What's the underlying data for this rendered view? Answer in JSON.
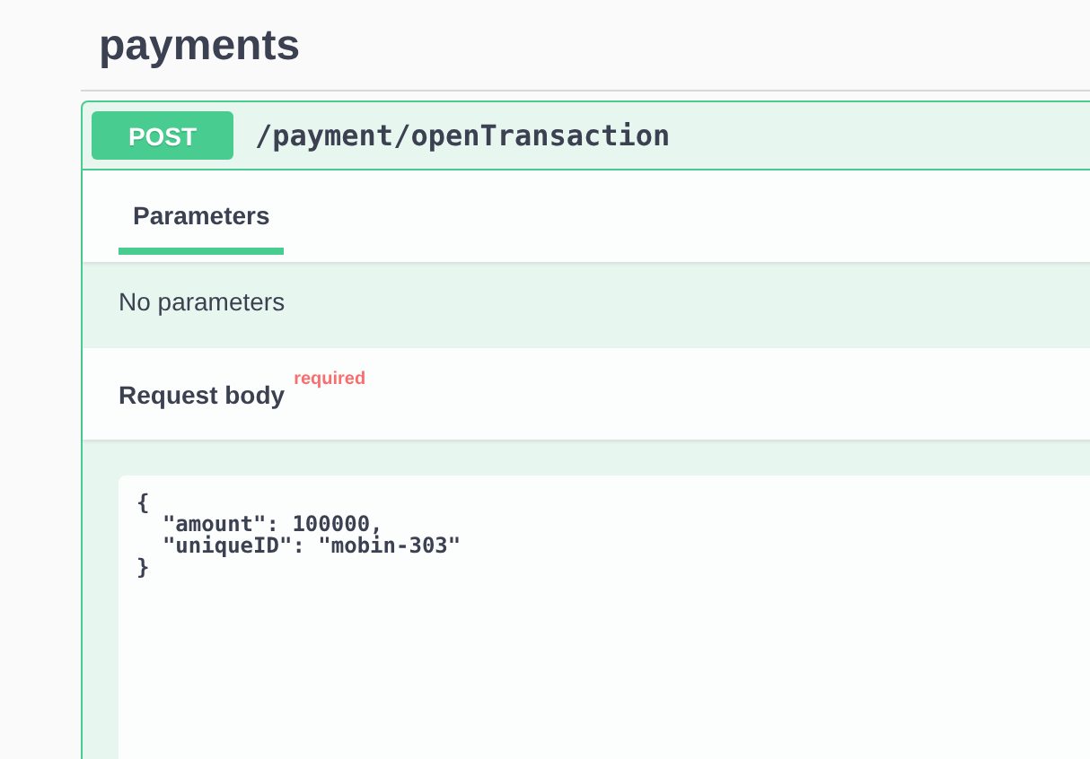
{
  "section": {
    "title": "payments"
  },
  "operation": {
    "method": "POST",
    "path": "/payment/openTransaction"
  },
  "tabs": [
    {
      "label": "Parameters",
      "selected": true
    }
  ],
  "parameters": {
    "message": "No parameters"
  },
  "request_body": {
    "label": "Request body",
    "required": true,
    "required_label": "required",
    "value": "{\n  \"amount\": 100000,\n  \"uniqueID\": \"mobin-303\"\n}"
  }
}
